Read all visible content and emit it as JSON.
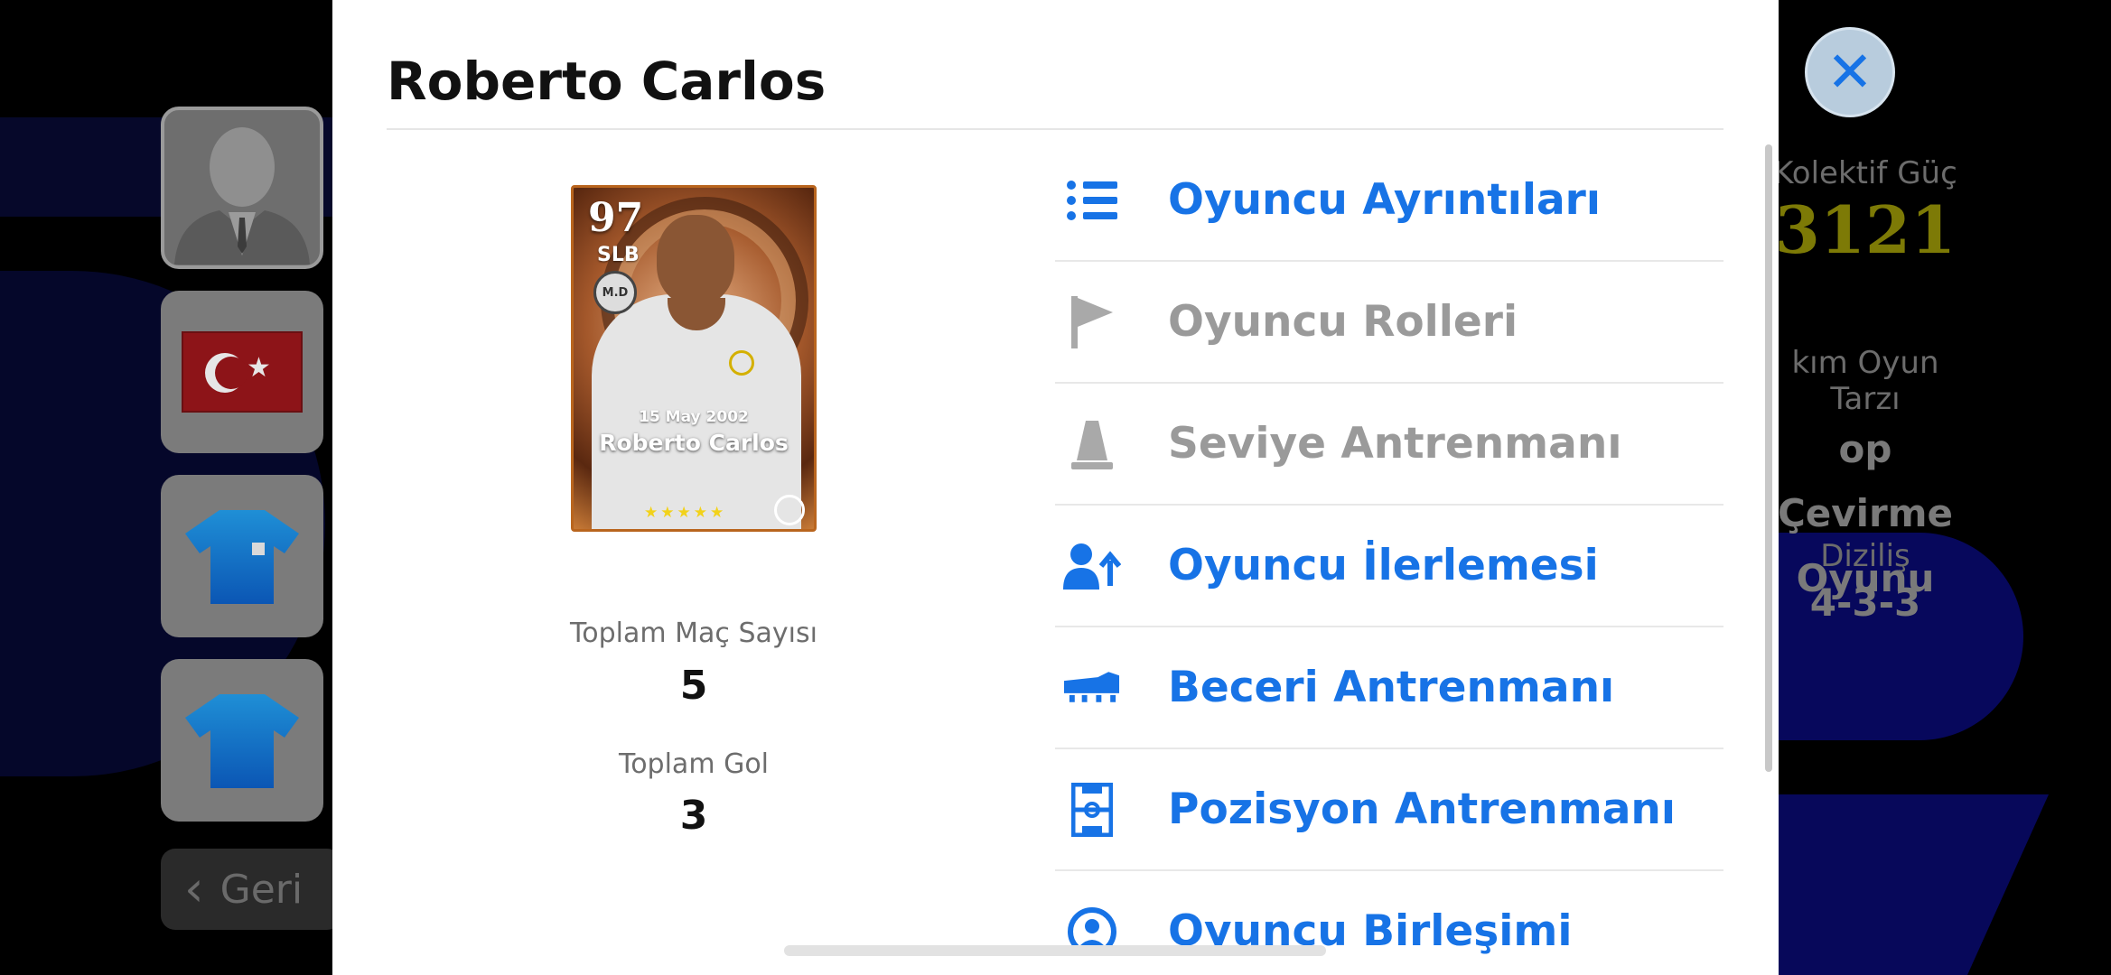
{
  "player": {
    "name": "Roberto Carlos",
    "card": {
      "rating": "97",
      "position": "SLB",
      "date": "15 May 2002",
      "name": "Roberto Carlos",
      "badge_text": "M.D"
    }
  },
  "stats": [
    {
      "label": "Toplam Maç Sayısı",
      "value": "5"
    },
    {
      "label": "Toplam Gol",
      "value": "3"
    }
  ],
  "menu": [
    {
      "label": "Oyuncu Ayrıntıları",
      "icon": "list-icon",
      "state": "active"
    },
    {
      "label": "Oyuncu Rolleri",
      "icon": "flag-icon",
      "state": "disabled"
    },
    {
      "label": "Seviye Antrenmanı",
      "icon": "training-cone-icon",
      "state": "disabled"
    },
    {
      "label": "Oyuncu İlerlemesi",
      "icon": "player-progress-icon",
      "state": "active"
    },
    {
      "label": "Beceri Antrenmanı",
      "icon": "boot-icon",
      "state": "active"
    },
    {
      "label": "Pozisyon Antrenmanı",
      "icon": "pitch-icon",
      "state": "active"
    },
    {
      "label": "Oyuncu Birleşimi",
      "icon": "player-merge-icon",
      "state": "active"
    }
  ],
  "background": {
    "back_label": "Geri",
    "collective_power_label": "Kolektif Güç",
    "collective_power_value": "3121",
    "play_style_label": "kım Oyun Tarzı",
    "play_style_value_line1": "op Çevirme",
    "play_style_value_line2": "Oyunu",
    "formation_label": "Diziliş",
    "formation_value": "4-3-3"
  },
  "colors": {
    "accent": "#1773e6",
    "disabled": "#9a9a9a",
    "power": "#7d7a06"
  }
}
